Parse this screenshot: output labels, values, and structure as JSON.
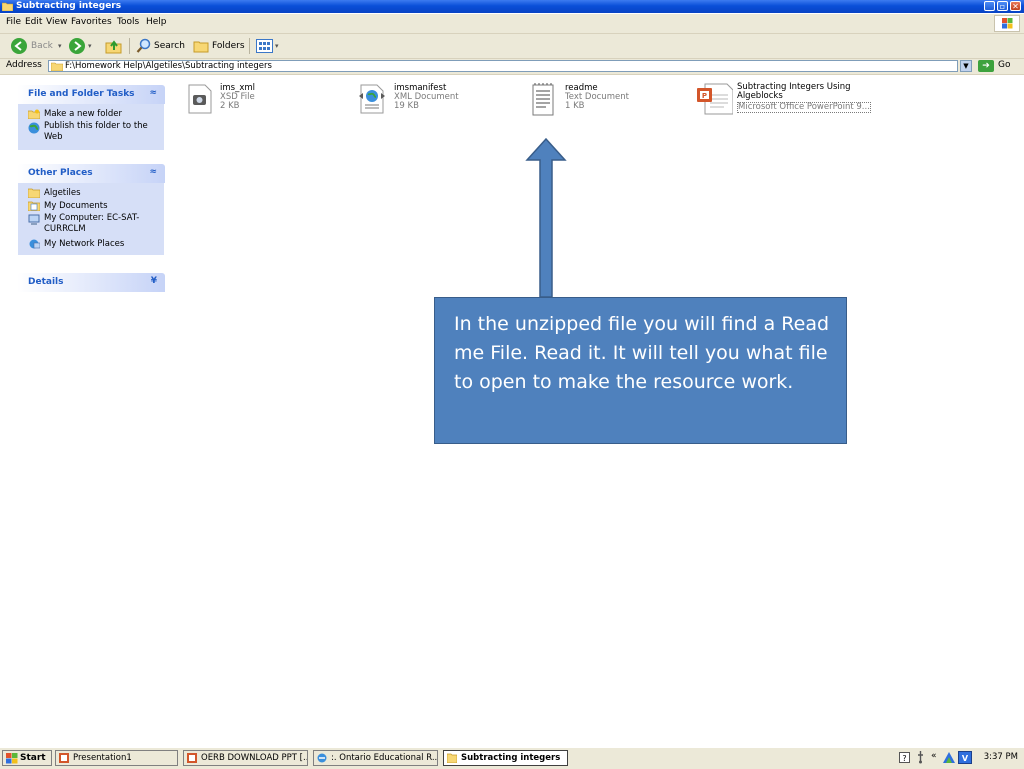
{
  "window": {
    "title": "Subtracting integers"
  },
  "menu": [
    "File",
    "Edit",
    "View",
    "Favorites",
    "Tools",
    "Help"
  ],
  "toolbar": {
    "back_label": "Back",
    "search_label": "Search",
    "folders_label": "Folders"
  },
  "address": {
    "label": "Address",
    "value": "F:\\Homework Help\\Algetiles\\Subtracting integers",
    "go_label": "Go"
  },
  "tasks_panel": {
    "title": "File and Folder Tasks",
    "items": [
      "Make a new folder",
      "Publish this folder to the Web"
    ]
  },
  "places_panel": {
    "title": "Other Places",
    "items": [
      "Algetiles",
      "My Documents",
      "My Computer: EC-SAT-CURRCLM",
      "My Network Places"
    ]
  },
  "details_panel": {
    "title": "Details"
  },
  "files": [
    {
      "name": "ims_xml",
      "type": "XSD File",
      "size": "2 KB"
    },
    {
      "name": "imsmanifest",
      "type": "XML Document",
      "size": "19 KB"
    },
    {
      "name": "readme",
      "type": "Text Document",
      "size": "1 KB"
    },
    {
      "name": "Subtracting Integers Using Algeblocks",
      "type": "Microsoft Office PowerPoint 9..."
    }
  ],
  "callout": {
    "text": "In the unzipped file you will find a Read me File.  Read it.  It will tell you what file to open to make the resource work."
  },
  "taskbar": {
    "start_label": "Start",
    "tasks": [
      "Presentation1",
      "OERB DOWNLOAD PPT [...",
      ":. Ontario Educational R...",
      "Subtracting integers"
    ],
    "clock": "3:37 PM"
  },
  "colors": {
    "titlebar": "#0a4fd8",
    "callout_fill": "#4f81bd",
    "arrow_fill": "#4f81bd",
    "panel_bg": "#d6dff7",
    "chrome": "#ece9d8"
  }
}
